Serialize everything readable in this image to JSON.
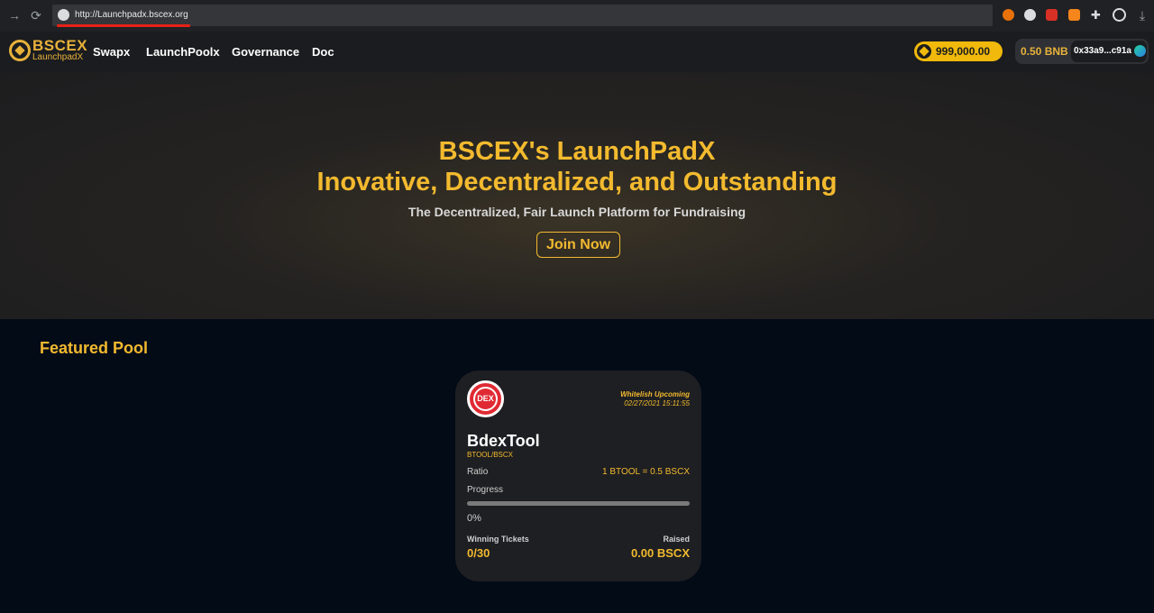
{
  "browser": {
    "url": "http://Launchpadx.bscex.org"
  },
  "brand": {
    "name": "BSCEX",
    "subtitle": "LaunchpadX"
  },
  "nav": {
    "links": [
      "Swapx",
      "LaunchPoolx",
      "Governance",
      "Doc"
    ]
  },
  "wallet": {
    "balance": "999,000.00",
    "bnb": "0.50 BNB",
    "address": "0x33a9...c91a"
  },
  "hero": {
    "title_line1": "BSCEX's LaunchPadX",
    "title_line2": "Inovative, Decentralized, and Outstanding",
    "subtitle": "The Decentralized, Fair Launch Platform for Fundraising",
    "cta": "Join Now"
  },
  "featured": {
    "section_title": "Featured Pool",
    "pool": {
      "logo_text": "DEX",
      "status": "Whitelish Upcoming",
      "date": "02/27/2021 15:11:55",
      "name": "BdexTool",
      "pair": "BTOOL/BSCX",
      "ratio_label": "Ratio",
      "ratio_value": "1 BTOOL = 0.5 BSCX",
      "progress_label": "Progress",
      "progress_percent": "0%",
      "progress_fraction": 0,
      "tickets_label": "Winning Tickets",
      "tickets_value": "0/30",
      "raised_label": "Raised",
      "raised_value": "0.00 BSCX"
    }
  },
  "colors": {
    "accent": "#f3ba2f",
    "background": "#030b17",
    "card": "#1e1f22"
  }
}
